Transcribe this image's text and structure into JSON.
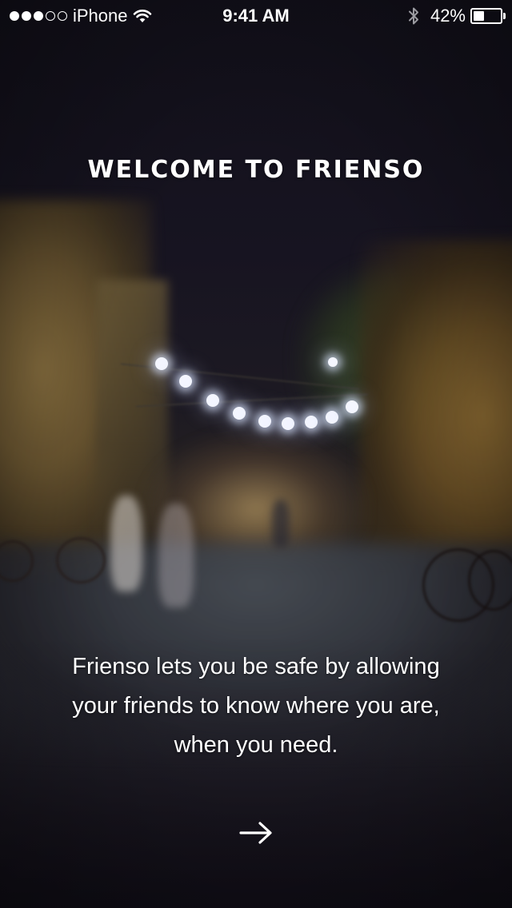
{
  "status_bar": {
    "signal_strength": "3 of 5 bars",
    "carrier": "iPhone",
    "time": "9:41 AM",
    "battery_percent": "42%",
    "battery_level": 0.42,
    "icons": [
      "wifi-icon",
      "bluetooth-icon",
      "battery-icon"
    ]
  },
  "onboarding": {
    "title": "WELCOME TO FRIENSO",
    "description": "Frienso lets you be safe by allowing your friends to know where you are, when you need.",
    "next_icon": "arrow-right-icon"
  },
  "colors": {
    "text": "#ffffff",
    "background": "#14121c"
  }
}
